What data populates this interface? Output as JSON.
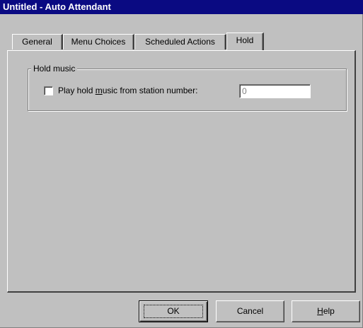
{
  "window": {
    "title": "Untitled - Auto Attendant"
  },
  "tabs": [
    {
      "label": "General",
      "active": false
    },
    {
      "label": "Menu Choices",
      "active": false
    },
    {
      "label": "Scheduled Actions",
      "active": false
    },
    {
      "label": "Hold",
      "active": true
    }
  ],
  "hold_music": {
    "group_label": "Hold music",
    "checkbox_label_pre": "Play hold ",
    "checkbox_label_mnemonic": "m",
    "checkbox_label_post": "usic from station number:",
    "checked": false,
    "station_number_value": "0"
  },
  "buttons": {
    "ok_label": "OK",
    "cancel_label": "Cancel",
    "help_mnemonic": "H",
    "help_rest": "elp"
  },
  "colors": {
    "titlebar": "#0a0a82",
    "face": "#c0c0c0"
  }
}
